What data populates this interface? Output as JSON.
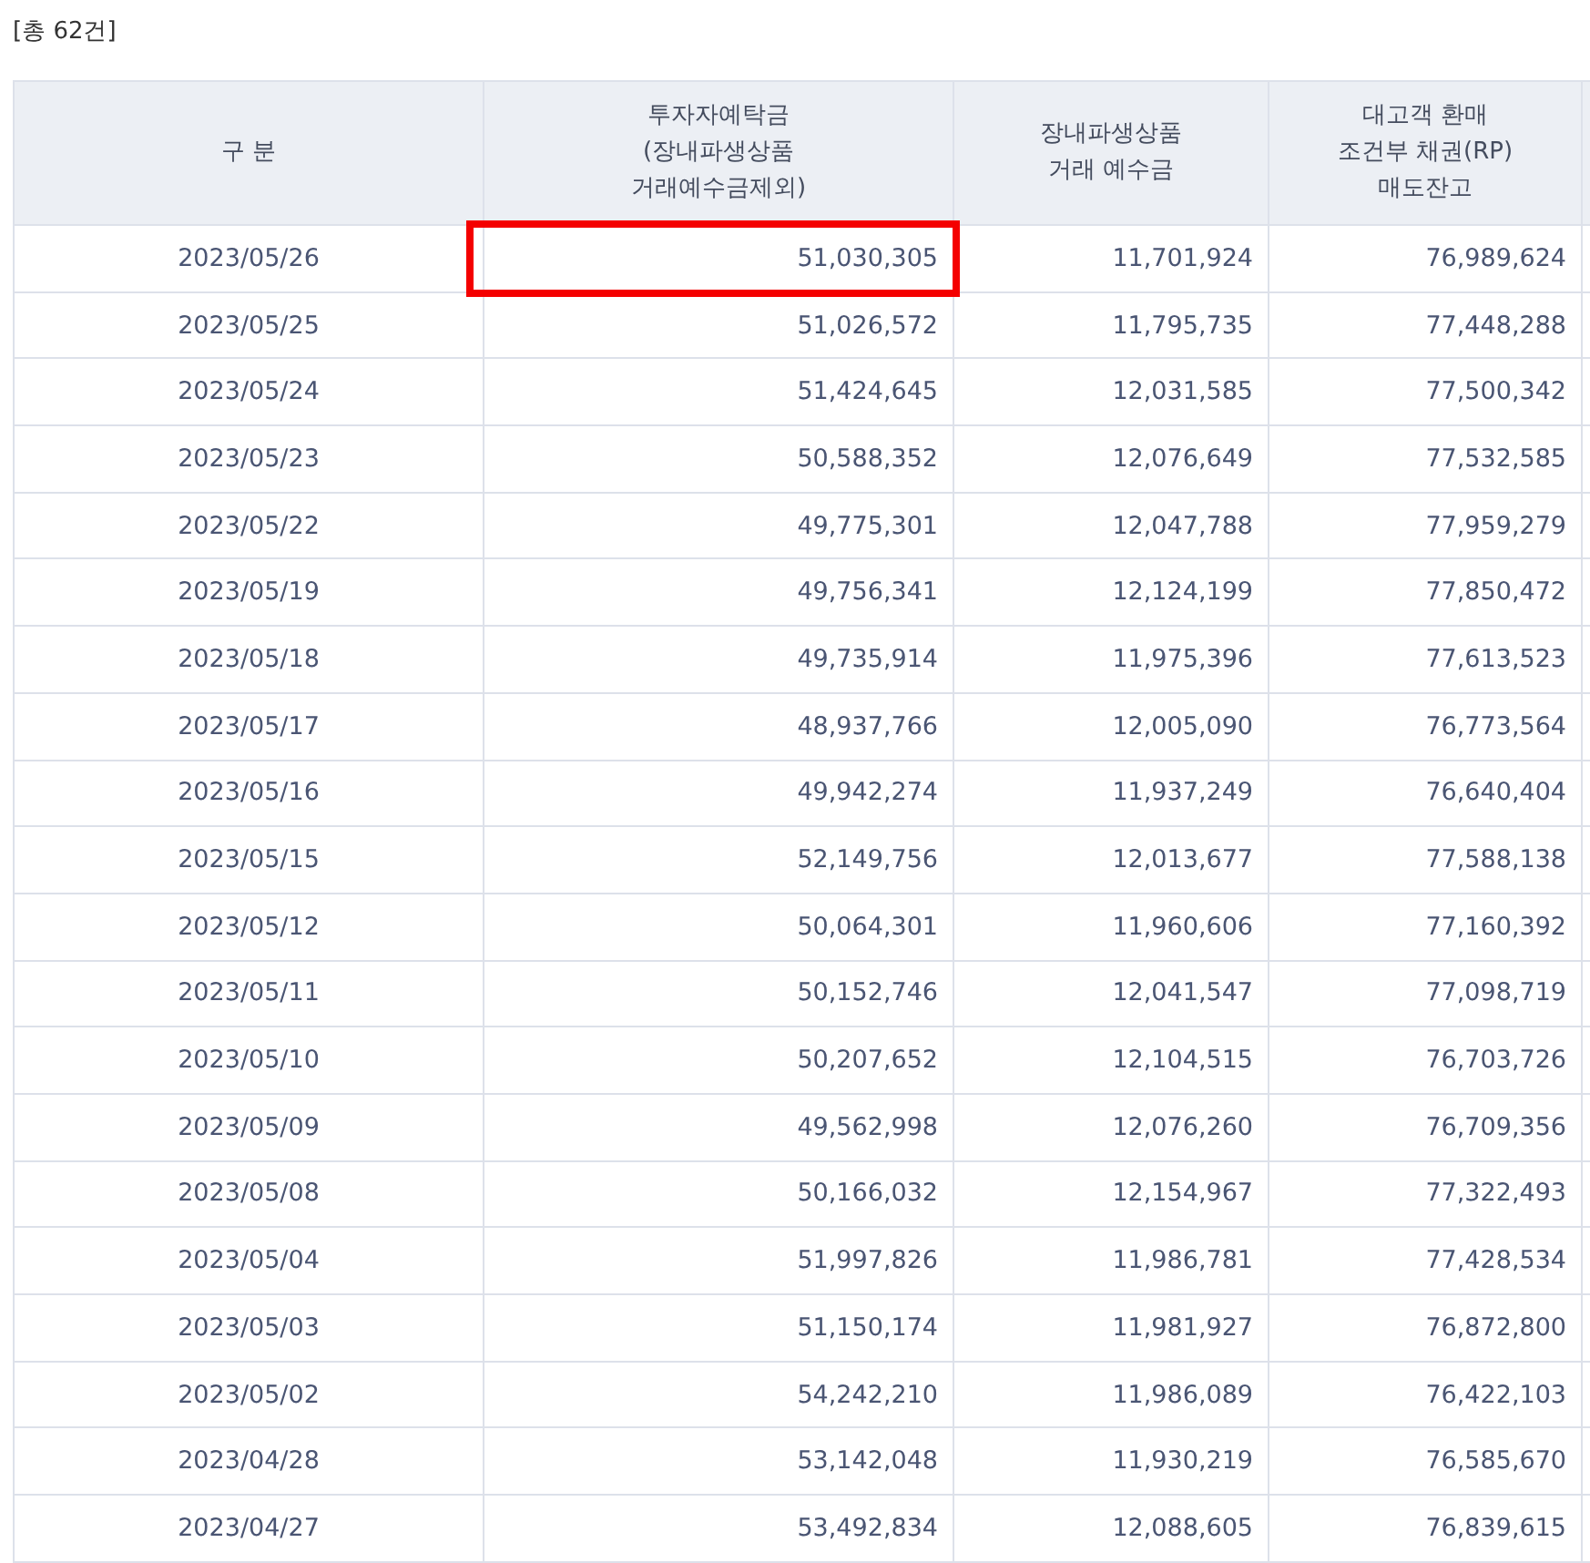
{
  "summary": "[총 62건]",
  "table": {
    "columns": [
      "구 분",
      "투자자예탁금\n(장내파생상품\n거래예수금제외)",
      "장내파생상품\n거래 예수금",
      "대고객 환매\n조건부 채권(RP)\n매도잔고"
    ],
    "rows": [
      {
        "date": "2023/05/26",
        "deposit": "51,030,305",
        "derivatives": "11,701,924",
        "rp": "76,989,624",
        "highlighted": true
      },
      {
        "date": "2023/05/25",
        "deposit": "51,026,572",
        "derivatives": "11,795,735",
        "rp": "77,448,288",
        "highlighted": false
      },
      {
        "date": "2023/05/24",
        "deposit": "51,424,645",
        "derivatives": "12,031,585",
        "rp": "77,500,342",
        "highlighted": false
      },
      {
        "date": "2023/05/23",
        "deposit": "50,588,352",
        "derivatives": "12,076,649",
        "rp": "77,532,585",
        "highlighted": false
      },
      {
        "date": "2023/05/22",
        "deposit": "49,775,301",
        "derivatives": "12,047,788",
        "rp": "77,959,279",
        "highlighted": false
      },
      {
        "date": "2023/05/19",
        "deposit": "49,756,341",
        "derivatives": "12,124,199",
        "rp": "77,850,472",
        "highlighted": false
      },
      {
        "date": "2023/05/18",
        "deposit": "49,735,914",
        "derivatives": "11,975,396",
        "rp": "77,613,523",
        "highlighted": false
      },
      {
        "date": "2023/05/17",
        "deposit": "48,937,766",
        "derivatives": "12,005,090",
        "rp": "76,773,564",
        "highlighted": false
      },
      {
        "date": "2023/05/16",
        "deposit": "49,942,274",
        "derivatives": "11,937,249",
        "rp": "76,640,404",
        "highlighted": false
      },
      {
        "date": "2023/05/15",
        "deposit": "52,149,756",
        "derivatives": "12,013,677",
        "rp": "77,588,138",
        "highlighted": false
      },
      {
        "date": "2023/05/12",
        "deposit": "50,064,301",
        "derivatives": "11,960,606",
        "rp": "77,160,392",
        "highlighted": false
      },
      {
        "date": "2023/05/11",
        "deposit": "50,152,746",
        "derivatives": "12,041,547",
        "rp": "77,098,719",
        "highlighted": false
      },
      {
        "date": "2023/05/10",
        "deposit": "50,207,652",
        "derivatives": "12,104,515",
        "rp": "76,703,726",
        "highlighted": false
      },
      {
        "date": "2023/05/09",
        "deposit": "49,562,998",
        "derivatives": "12,076,260",
        "rp": "76,709,356",
        "highlighted": false
      },
      {
        "date": "2023/05/08",
        "deposit": "50,166,032",
        "derivatives": "12,154,967",
        "rp": "77,322,493",
        "highlighted": false
      },
      {
        "date": "2023/05/04",
        "deposit": "51,997,826",
        "derivatives": "11,986,781",
        "rp": "77,428,534",
        "highlighted": false
      },
      {
        "date": "2023/05/03",
        "deposit": "51,150,174",
        "derivatives": "11,981,927",
        "rp": "76,872,800",
        "highlighted": false
      },
      {
        "date": "2023/05/02",
        "deposit": "54,242,210",
        "derivatives": "11,986,089",
        "rp": "76,422,103",
        "highlighted": false
      },
      {
        "date": "2023/04/28",
        "deposit": "53,142,048",
        "derivatives": "11,930,219",
        "rp": "76,585,670",
        "highlighted": false
      },
      {
        "date": "2023/04/27",
        "deposit": "53,492,834",
        "derivatives": "12,088,605",
        "rp": "76,839,615",
        "highlighted": false
      }
    ]
  }
}
